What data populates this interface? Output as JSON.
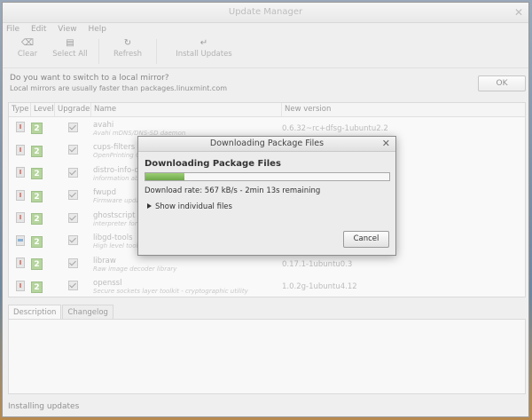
{
  "window": {
    "title": "Update Manager"
  },
  "menu": [
    "File",
    "Edit",
    "View",
    "Help"
  ],
  "toolbar": {
    "clear": "Clear",
    "select_all": "Select All",
    "refresh": "Refresh",
    "install": "Install Updates"
  },
  "mirror": {
    "question": "Do you want to switch to a local mirror?",
    "subtext": "Local mirrors are usually faster than packages.linuxmint.com",
    "ok_label": "OK"
  },
  "columns": {
    "type": "Type",
    "level": "Level",
    "upgrade": "Upgrade",
    "name": "Name",
    "new_version": "New version"
  },
  "packages": [
    {
      "type": "security-icon",
      "level": "2",
      "name": "avahi",
      "desc": "Avahi mDNS/DNS-SD daemon",
      "version": "0.6.32~rc+dfsg-1ubuntu2.2"
    },
    {
      "type": "security-icon",
      "level": "2",
      "name": "cups-filters",
      "desc": "OpenPrinting CUPS Filters",
      "version": ""
    },
    {
      "type": "security-icon",
      "level": "2",
      "name": "distro-info-data",
      "desc": "information about the distributions' releases",
      "version": ""
    },
    {
      "type": "security-icon",
      "level": "2",
      "name": "fwupd",
      "desc": "Firmware update daemon",
      "version": ""
    },
    {
      "type": "security-icon",
      "level": "2",
      "name": "ghostscript",
      "desc": "interpreter for the PostScript language and for PDF",
      "version": ""
    },
    {
      "type": "backport-icon",
      "level": "2",
      "name": "libgd-tools",
      "desc": "High level tools for working with images",
      "version": ""
    },
    {
      "type": "security-icon",
      "level": "2",
      "name": "libraw",
      "desc": "Raw image decoder library",
      "version": "0.17.1-1ubuntu0.3"
    },
    {
      "type": "security-icon",
      "level": "2",
      "name": "openssl",
      "desc": "Secure sockets layer toolkit - cryptographic utility",
      "version": "1.0.2g-1ubuntu4.12"
    }
  ],
  "tabs": {
    "description": "Description",
    "changelog": "Changelog"
  },
  "status": "Installing updates",
  "dialog": {
    "title": "Downloading Package Files",
    "heading": "Downloading Package Files",
    "progress": 0.16,
    "rate": "Download rate: 567 kB/s - 2min 13s remaining",
    "expander": "Show individual files",
    "cancel": "Cancel"
  }
}
